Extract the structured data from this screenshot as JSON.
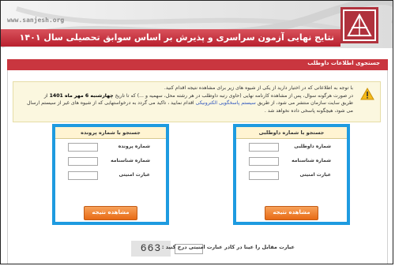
{
  "header": {
    "watermark": "www.sanjesh.org",
    "title": "نتایج نهایی آزمون سراسری و پذیرش بر اساس سوابق تحصیلی سال ۱۴۰۱"
  },
  "panel": {
    "title": "جستجوی اطلاعات داوطلب"
  },
  "notice": {
    "line1": "با توجه به اطلاعاتی که در اختیار دارید از یکی از شیوه های زیر برای مشاهده نتیجه اقدام کنید.",
    "line2_pre": "در صورت هرگونه سوال، پس از مشاهده کارنامه نهایی (حاوی رتبه داوطلب در هر رشته محل، سهمیه و ...) که تا تاریخ",
    "line2_bold": "چهارشنبه 6 مهر ماه 1401",
    "line2_post": "از",
    "line3_pre": "طریق سایت سازمان منتشر می شود، از طریق",
    "line3_link": "سیستم پاسخگویی الکترونیکی",
    "line3_post": "اقدام نمایید ، تاکید می گردد به درخواستهایی که از شیوه های غیر از سیستم ارسال",
    "line4": "می شود، هیچگونه پاسخی داده نخواهد شد ."
  },
  "search_by_number": {
    "title": "جستجو با شماره داوطلبی",
    "fields": [
      "شماره داوطلبی",
      "شماره شناسنامه",
      "عبارت امنیتی"
    ],
    "button": "مشاهده نتیجه"
  },
  "search_by_file": {
    "title": "جستجو با شماره پرونده",
    "fields": [
      "شماره پرونده",
      "شماره شناسنامه",
      "عبارت امنیتی"
    ],
    "button": "مشاهده نتیجه"
  },
  "captcha": {
    "code": "663",
    "label": "عبارت مقابل را عینا در کادر عبارت امنیتی درج کنید :"
  },
  "colors": {
    "brand_red": "#b8202e",
    "highlight_blue": "#1e9be0",
    "button_orange": "#e86a15"
  }
}
